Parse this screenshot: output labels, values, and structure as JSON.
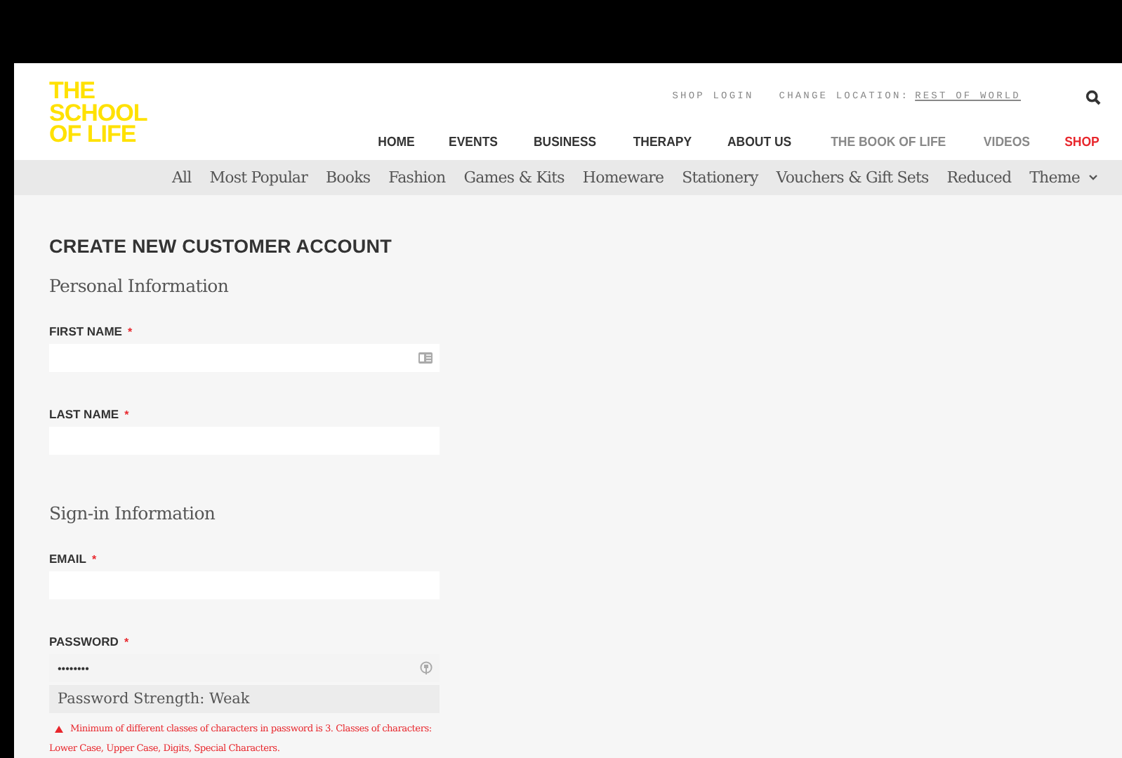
{
  "logo": {
    "lines": [
      "THE",
      "SCHOOL",
      "OF LIFE"
    ]
  },
  "top_links": [
    {
      "label": "SHOP LOGIN"
    },
    {
      "label": "CHANGE LOCATION:",
      "link": "REST OF WORLD"
    }
  ],
  "main_nav": [
    {
      "label": "HOME",
      "selected": false,
      "muted": false
    },
    {
      "label": "EVENTS",
      "selected": false,
      "muted": false
    },
    {
      "label": "BUSINESS",
      "selected": false,
      "muted": false
    },
    {
      "label": "THERAPY",
      "selected": false,
      "muted": false
    },
    {
      "label": "ABOUT US",
      "selected": false,
      "muted": false
    },
    {
      "label": "THE BOOK OF LIFE",
      "selected": false,
      "muted": true
    },
    {
      "label": "VIDEOS",
      "selected": false,
      "muted": true
    },
    {
      "label": "SHOP",
      "selected": true,
      "muted": false
    }
  ],
  "sub_nav": [
    {
      "label": "All",
      "dropdown": false
    },
    {
      "label": "Most Popular",
      "dropdown": false
    },
    {
      "label": "Books",
      "dropdown": false
    },
    {
      "label": "Fashion",
      "dropdown": false
    },
    {
      "label": "Games & Kits",
      "dropdown": false
    },
    {
      "label": "Homeware",
      "dropdown": false
    },
    {
      "label": "Stationery",
      "dropdown": false
    },
    {
      "label": "Vouchers & Gift Sets",
      "dropdown": false
    },
    {
      "label": "Reduced",
      "dropdown": false
    },
    {
      "label": "Theme",
      "dropdown": true
    }
  ],
  "form": {
    "title": "CREATE NEW CUSTOMER ACCOUNT",
    "sections": [
      {
        "heading": "Personal Information",
        "fields": [
          {
            "label": "FIRST NAME",
            "required_mark": "*",
            "kind": "autofill"
          },
          {
            "label": "LAST NAME",
            "required_mark": "*",
            "kind": "plain"
          }
        ]
      },
      {
        "heading": "Sign-in Information",
        "fields": [
          {
            "label": "EMAIL",
            "required_mark": "*",
            "kind": "plain"
          },
          {
            "label": "PASSWORD",
            "required_mark": "*",
            "kind": "password",
            "value": "••••••••",
            "strength": "Password Strength: Weak",
            "error": "Minimum of different classes of characters in password is 3. Classes of characters: Lower Case, Upper Case, Digits, Special Characters."
          }
        ]
      }
    ]
  }
}
